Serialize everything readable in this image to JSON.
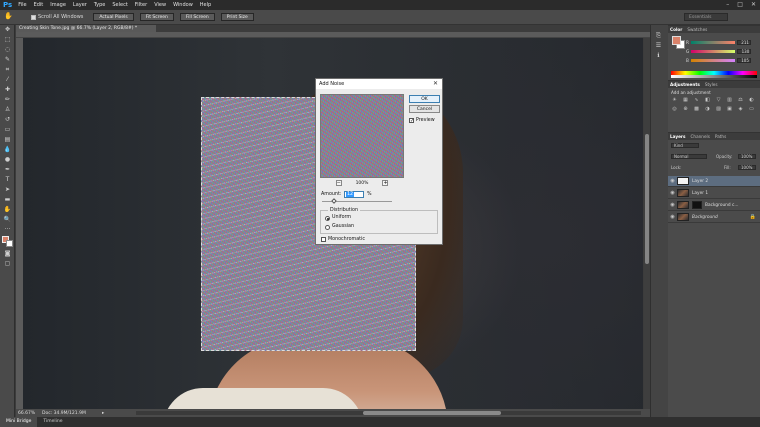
{
  "app": {
    "logo": "Ps"
  },
  "menu": [
    "File",
    "Edit",
    "Image",
    "Layer",
    "Type",
    "Select",
    "Filter",
    "View",
    "Window",
    "Help"
  ],
  "window_controls": [
    "–",
    "□",
    "✕"
  ],
  "options_bar": {
    "scroll_all_label": "Scroll All Windows",
    "buttons": [
      "Actual Pixels",
      "Fit Screen",
      "Fill Screen",
      "Print Size"
    ],
    "workspace": "Essentials"
  },
  "document": {
    "tab_title": "Creating Skin Tone.jpg @ 66.7% (Layer 2, RGB/8#) *",
    "zoom": "66.67%",
    "doc_size": "Doc: 34.9M/121.9M"
  },
  "bottom_tabs": [
    "Mini Bridge",
    "Timeline"
  ],
  "panels": {
    "color_tabs": [
      "Color",
      "Swatches"
    ],
    "color_values": [
      "211",
      "130",
      "105"
    ],
    "adjustments_tabs": [
      "Adjustments",
      "Styles"
    ],
    "adjustments_label": "Add an adjustment",
    "layers_tabs": [
      "Layers",
      "Channels",
      "Paths"
    ],
    "kind": "Kind",
    "blend_mode": "Normal",
    "opacity_label": "Opacity:",
    "opacity_value": "100%",
    "lock_label": "Lock:",
    "fill_label": "Fill:",
    "fill_value": "100%",
    "layers": [
      {
        "name": "Layer 2"
      },
      {
        "name": "Layer 1"
      },
      {
        "name": "Background c..."
      },
      {
        "name": "Background"
      }
    ]
  },
  "dialog": {
    "title": "Add Noise",
    "ok": "OK",
    "cancel": "Cancel",
    "preview_label": "Preview",
    "zoom_value": "100%",
    "amount_label": "Amount:",
    "amount_value": "12",
    "amount_unit": "%",
    "distribution_label": "Distribution",
    "uniform_label": "Uniform",
    "gaussian_label": "Gaussian",
    "monochromatic_label": "Monochromatic"
  },
  "colors": {
    "foreground": "#d9826a",
    "background": "#ffffff",
    "accent": "#31a8ff"
  }
}
